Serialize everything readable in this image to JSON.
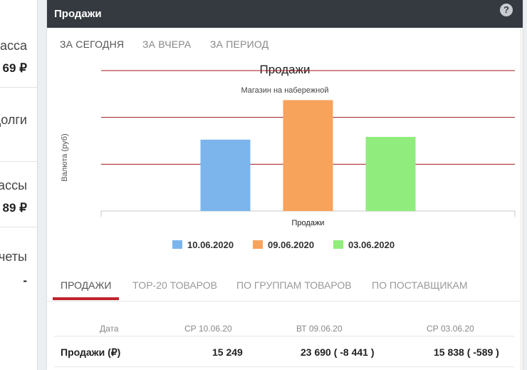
{
  "left_panel": {
    "items": [
      {
        "label": "касса",
        "value": "69 ₽"
      },
      {
        "label": "долги",
        "value": ""
      },
      {
        "label": "кассы",
        "value": "89 ₽"
      },
      {
        "label": "счеты",
        "value": "-"
      }
    ]
  },
  "card": {
    "title": "Продажи",
    "help": "?"
  },
  "period_tabs": [
    "ЗА СЕГОДНЯ",
    "ЗА ВЧЕРА",
    "ЗА ПЕРИОД"
  ],
  "chart_data": {
    "type": "bar",
    "title": "Продажи",
    "subtitle": "Магазин на набережной",
    "ylabel": "Валюта (руб)",
    "xlabel": "",
    "categories": [
      "Продажи"
    ],
    "series": [
      {
        "name": "10.06.2020",
        "values": [
          15249
        ],
        "color": "#7cb5ec"
      },
      {
        "name": "09.06.2020",
        "values": [
          23690
        ],
        "color": "#f7a35c"
      },
      {
        "name": "03.06.2020",
        "values": [
          15838
        ],
        "color": "#90ed7d"
      }
    ],
    "ylim": [
      0,
      30000
    ],
    "grid": true,
    "legend": "bottom"
  },
  "bottom_tabs": [
    "ПРОДАЖИ",
    "TOP-20 ТОВАРОВ",
    "ПО ГРУППАМ ТОВАРОВ",
    "ПО ПОСТАВЩИКАМ"
  ],
  "table": {
    "headers": [
      "Дата",
      "СР 10.06.20",
      "ВТ 09.06.20",
      "СР 03.06.20"
    ],
    "rows": [
      {
        "label": "Продажи (₽)",
        "cells": [
          "15 249",
          "23 690 ( -8 441 )",
          "15 838 ( -589 )"
        ]
      }
    ]
  }
}
